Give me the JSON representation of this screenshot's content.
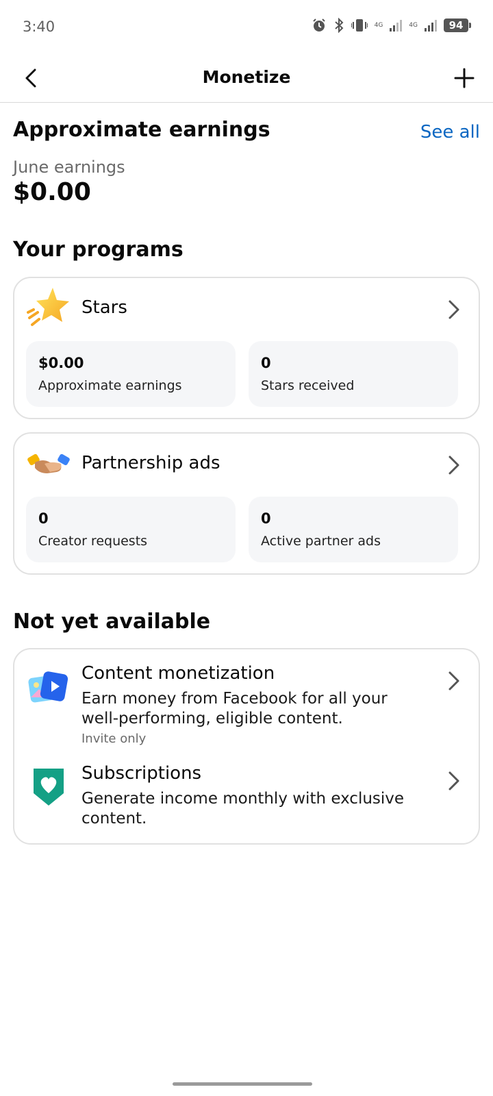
{
  "status": {
    "time": "3:40",
    "network_1": "4G",
    "network_2": "4G",
    "battery": "94",
    "icons": [
      "alarm-icon",
      "bluetooth-icon",
      "vibrate-icon",
      "signal-icon",
      "signal-icon",
      "battery-icon"
    ]
  },
  "header": {
    "title": "Monetize",
    "back_icon": "chevron-left-icon",
    "add_icon": "plus-icon"
  },
  "earnings": {
    "title": "Approximate earnings",
    "see_all": "See all",
    "period_label": "June earnings",
    "value": "$0.00"
  },
  "programs": {
    "title": "Your programs",
    "items": [
      {
        "name": "Stars",
        "icon": "star-icon",
        "stats": [
          {
            "value": "$0.00",
            "label": "Approximate earnings"
          },
          {
            "value": "0",
            "label": "Stars received"
          }
        ]
      },
      {
        "name": "Partnership ads",
        "icon": "handshake-icon",
        "stats": [
          {
            "value": "0",
            "label": "Creator requests"
          },
          {
            "value": "0",
            "label": "Active partner ads"
          }
        ]
      }
    ]
  },
  "not_available": {
    "title": "Not yet available",
    "items": [
      {
        "title": "Content monetization",
        "description": "Earn money from Facebook for all your well-performing, eligible content.",
        "note": "Invite only",
        "icon": "content-monetization-icon"
      },
      {
        "title": "Subscriptions",
        "description": "Generate income monthly with exclusive content.",
        "icon": "subscription-heart-icon"
      }
    ]
  },
  "colors": {
    "link": "#0a66c2",
    "card_border": "#e1e1e1",
    "stat_bg": "#f5f6f8"
  }
}
